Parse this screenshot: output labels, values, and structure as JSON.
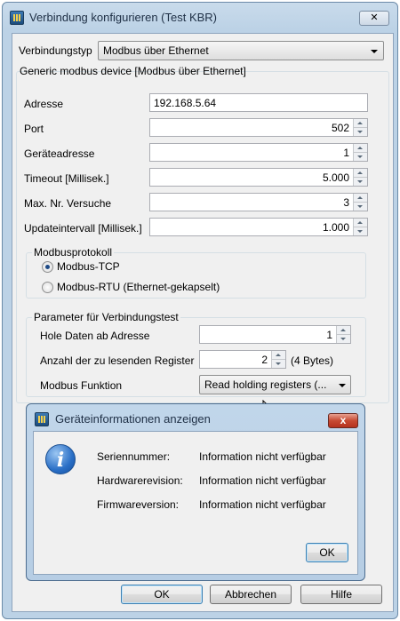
{
  "window": {
    "title": "Verbindung konfigurieren (Test KBR)",
    "close_glyph": "✕",
    "app_icon": "app-icon"
  },
  "connection_type": {
    "label": "Verbindungstyp",
    "value": "Modbus über Ethernet"
  },
  "device_section": {
    "title": "Generic modbus device [Modbus über Ethernet]"
  },
  "fields": {
    "address": {
      "label": "Adresse",
      "value": "192.168.5.64"
    },
    "port": {
      "label": "Port",
      "value": "502"
    },
    "device_address": {
      "label": "Geräteadresse",
      "value": "1"
    },
    "timeout": {
      "label": "Timeout [Millisek.]",
      "value": "5.000"
    },
    "max_tries": {
      "label": "Max. Nr. Versuche",
      "value": "3"
    },
    "update_interval": {
      "label": "Updateintervall [Millisek.]",
      "value": "1.000"
    }
  },
  "protocol": {
    "title": "Modbusprotokoll",
    "options": [
      {
        "label": "Modbus-TCP",
        "selected": true
      },
      {
        "label": "Modbus-RTU (Ethernet-gekapselt)",
        "selected": false
      }
    ]
  },
  "test_params": {
    "title": "Parameter für Verbindungstest",
    "start_address": {
      "label": "Hole Daten ab Adresse",
      "value": "1"
    },
    "register_count": {
      "label": "Anzahl der zu lesenden Register",
      "value": "2",
      "suffix": "(4 Bytes)"
    },
    "function": {
      "label": "Modbus Funktion",
      "value": "Read holding registers (..."
    }
  },
  "buttons": {
    "ok": "OK",
    "cancel": "Abbrechen",
    "help": "Hilfe"
  },
  "modal": {
    "title": "Geräteinformationen anzeigen",
    "close_glyph": "x",
    "icon": "info-icon",
    "icon_glyph": "i",
    "rows": [
      {
        "label": "Seriennummer:",
        "value": "Information nicht verfügbar"
      },
      {
        "label": "Hardwarerevision:",
        "value": "Information nicht verfügbar"
      },
      {
        "label": "Firmwareversion:",
        "value": "Information nicht verfügbar"
      }
    ],
    "ok": "OK"
  },
  "colors": {
    "title_bar": "#bcd2e6",
    "dialog_bg": "#f0f0f0",
    "close_red": "#c74a33",
    "info_blue": "#2a6fc6"
  }
}
